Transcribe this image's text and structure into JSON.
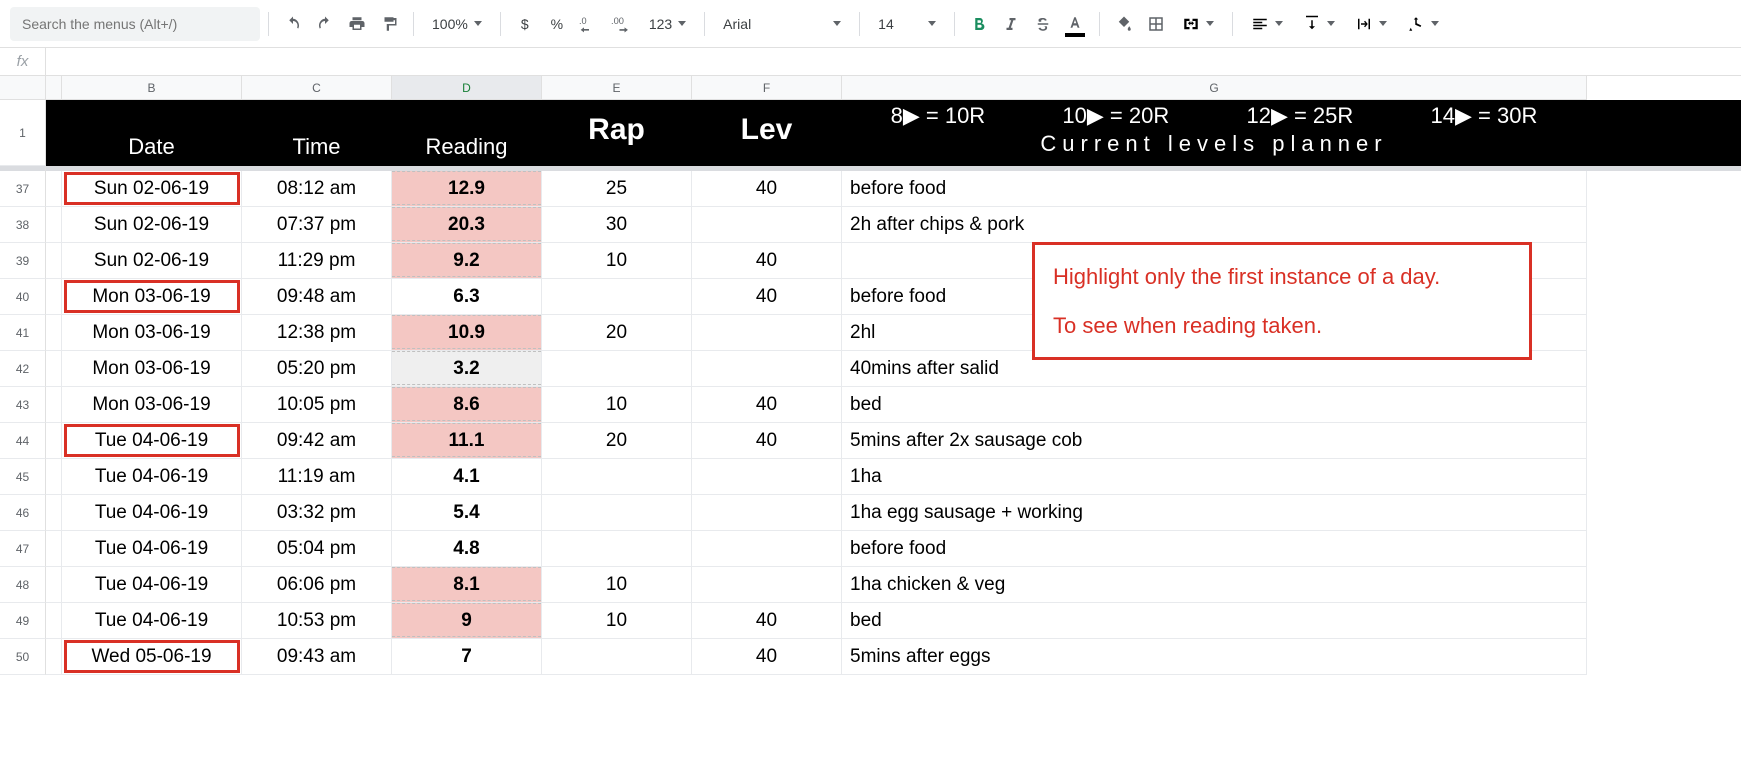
{
  "toolbar": {
    "search_placeholder": "Search the menus (Alt+/)",
    "zoom": "100%",
    "font_name": "Arial",
    "font_size": "14"
  },
  "columns": [
    "",
    "B",
    "C",
    "D",
    "E",
    "F",
    "G"
  ],
  "selected_column": "D",
  "header": {
    "date": "Date",
    "time": "Time",
    "reading": "Reading",
    "rap": "Rap",
    "lev": "Lev",
    "g_top": [
      "8▶ = 10R",
      "10▶ = 20R",
      "12▶ = 25R",
      "14▶ = 30R"
    ],
    "g_bot": "Current levels planner"
  },
  "row_numbers": [
    "1",
    "37",
    "38",
    "39",
    "40",
    "41",
    "42",
    "43",
    "44",
    "45",
    "46",
    "47",
    "48",
    "49",
    "50"
  ],
  "rows": [
    {
      "date": "Sun 02-06-19",
      "time": "08:12 am",
      "reading": "12.9",
      "reading_bg": "pink",
      "rap": "25",
      "lev": "40",
      "note": "before food",
      "first": true
    },
    {
      "date": "Sun 02-06-19",
      "time": "07:37 pm",
      "reading": "20.3",
      "reading_bg": "pink",
      "rap": "30",
      "lev": "",
      "note": "2h after chips & pork",
      "first": false
    },
    {
      "date": "Sun 02-06-19",
      "time": "11:29 pm",
      "reading": "9.2",
      "reading_bg": "pink",
      "rap": "10",
      "lev": "40",
      "note": "",
      "first": false
    },
    {
      "date": "Mon 03-06-19",
      "time": "09:48 am",
      "reading": "6.3",
      "reading_bg": "",
      "rap": "",
      "lev": "40",
      "note": "before food",
      "first": true
    },
    {
      "date": "Mon 03-06-19",
      "time": "12:38 pm",
      "reading": "10.9",
      "reading_bg": "pink",
      "rap": "20",
      "lev": "",
      "note": "2hl",
      "first": false
    },
    {
      "date": "Mon 03-06-19",
      "time": "05:20 pm",
      "reading": "3.2",
      "reading_bg": "gray",
      "rap": "",
      "lev": "",
      "note": "40mins after salid",
      "first": false
    },
    {
      "date": "Mon 03-06-19",
      "time": "10:05 pm",
      "reading": "8.6",
      "reading_bg": "pink",
      "rap": "10",
      "lev": "40",
      "note": "bed",
      "first": false
    },
    {
      "date": "Tue 04-06-19",
      "time": "09:42 am",
      "reading": "11.1",
      "reading_bg": "pink",
      "rap": "20",
      "lev": "40",
      "note": "5mins after 2x sausage cob",
      "first": true
    },
    {
      "date": "Tue 04-06-19",
      "time": "11:19 am",
      "reading": "4.1",
      "reading_bg": "",
      "rap": "",
      "lev": "",
      "note": "1ha",
      "first": false
    },
    {
      "date": "Tue 04-06-19",
      "time": "03:32 pm",
      "reading": "5.4",
      "reading_bg": "",
      "rap": "",
      "lev": "",
      "note": "1ha egg sausage + working",
      "first": false
    },
    {
      "date": "Tue 04-06-19",
      "time": "05:04 pm",
      "reading": "4.8",
      "reading_bg": "",
      "rap": "",
      "lev": "",
      "note": "before food",
      "first": false
    },
    {
      "date": "Tue 04-06-19",
      "time": "06:06 pm",
      "reading": "8.1",
      "reading_bg": "pink",
      "rap": "10",
      "lev": "",
      "note": "1ha chicken & veg",
      "first": false
    },
    {
      "date": "Tue 04-06-19",
      "time": "10:53 pm",
      "reading": "9",
      "reading_bg": "pink",
      "rap": "10",
      "lev": "40",
      "note": "bed",
      "first": false
    },
    {
      "date": "Wed 05-06-19",
      "time": "09:43 am",
      "reading": "7",
      "reading_bg": "",
      "rap": "",
      "lev": "40",
      "note": "5mins after eggs",
      "first": true
    }
  ],
  "annotation": {
    "line1": "Highlight only the first instance of a day.",
    "line2": "To see when reading taken."
  }
}
